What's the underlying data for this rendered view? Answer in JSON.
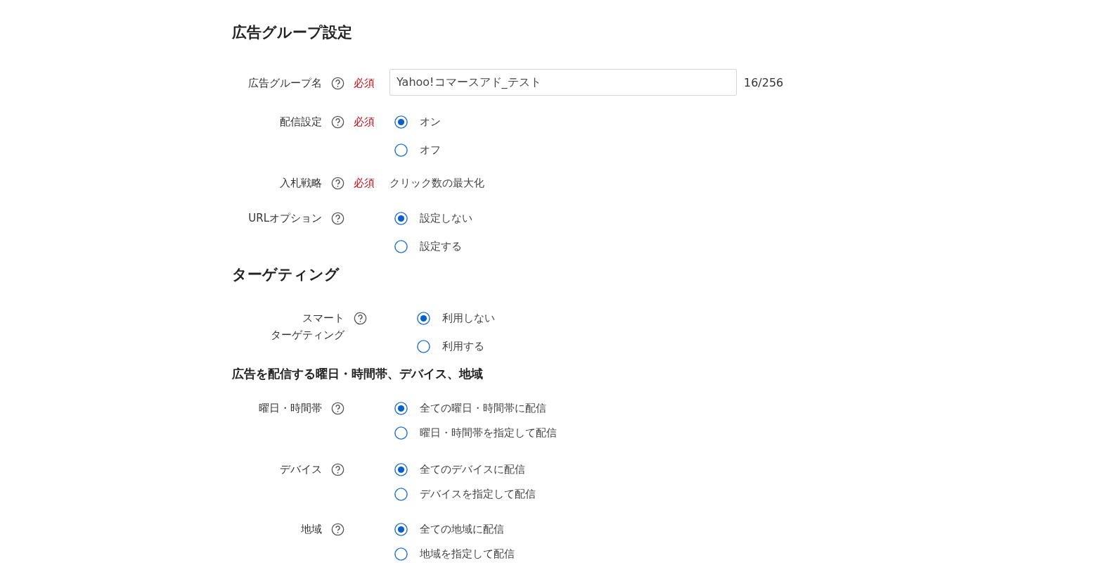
{
  "sections": [
    {
      "heading": "広告グループ設定",
      "kind": "main",
      "fields": [
        {
          "label": [
            "広告グループ名"
          ],
          "required": "必須",
          "kind": "text",
          "value": "Yahoo!コマースアド_テスト",
          "counter": "16/256"
        },
        {
          "label": [
            "配信設定"
          ],
          "required": "必須",
          "kind": "radio",
          "options": [
            {
              "label": "オン",
              "selected": true
            },
            {
              "label": "オフ",
              "selected": false
            }
          ]
        },
        {
          "label": [
            "入札戦略"
          ],
          "required": "必須",
          "kind": "static",
          "value": "クリック数の最大化"
        },
        {
          "label": [
            "URLオプション"
          ],
          "kind": "radio",
          "options": [
            {
              "label": "設定しない",
              "selected": true
            },
            {
              "label": "設定する",
              "selected": false
            }
          ]
        }
      ]
    },
    {
      "heading": "ターゲティング",
      "kind": "main",
      "fields": [
        {
          "label": [
            "スマート",
            "ターゲティング"
          ],
          "kind": "radio",
          "options": [
            {
              "label": "利用しない",
              "selected": true
            },
            {
              "label": "利用する",
              "selected": false
            }
          ]
        }
      ]
    },
    {
      "heading": "広告を配信する曜日・時間帯、デバイス、地域",
      "kind": "sub",
      "fields": [
        {
          "label": [
            "曜日・時間帯"
          ],
          "kind": "radio",
          "options": [
            {
              "label": "全ての曜日・時間帯に配信",
              "selected": true
            },
            {
              "label": "曜日・時間帯を指定して配信",
              "selected": false
            }
          ]
        },
        {
          "label": [
            "デバイス"
          ],
          "kind": "radio",
          "options": [
            {
              "label": "全てのデバイスに配信",
              "selected": true
            },
            {
              "label": "デバイスを指定して配信",
              "selected": false
            }
          ]
        },
        {
          "label": [
            "地域"
          ],
          "kind": "radio",
          "options": [
            {
              "label": "全ての地域に配信",
              "selected": true
            },
            {
              "label": "地域を指定して配信",
              "selected": false
            }
          ]
        }
      ]
    }
  ]
}
